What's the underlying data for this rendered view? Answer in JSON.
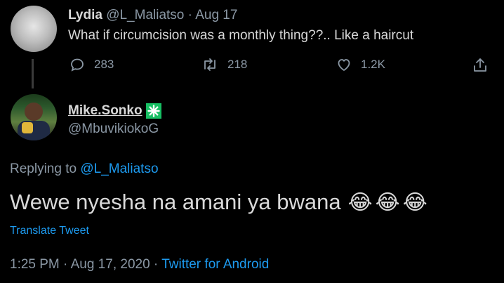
{
  "original_tweet": {
    "display_name": "Lydia",
    "handle": "@L_Maliatso",
    "separator": "·",
    "date": "Aug 17",
    "text": "What if circumcision was a monthly thing??.. Like a haircut",
    "reply_count": "283",
    "retweet_count": "218",
    "like_count": "1.2K"
  },
  "reply_tweet": {
    "display_name": "Mike.Sonko",
    "badge_icon": "green-star-badge-icon",
    "handle": "@MbuvikiokoG",
    "replying_prefix": "Replying to",
    "replying_handle": "@L_Maliatso",
    "text": "Wewe nyesha na amani ya bwana",
    "emojis": [
      "😂",
      "😂",
      "😂"
    ],
    "translate_label": "Translate Tweet",
    "timestamp": "1:25 PM · Aug 17, 2020 · ",
    "source": "Twitter for Android"
  },
  "colors": {
    "background": "#000000",
    "text": "#d9d9d9",
    "muted": "#8b98a5",
    "link": "#1d9bf0",
    "badge": "#17bf63"
  }
}
